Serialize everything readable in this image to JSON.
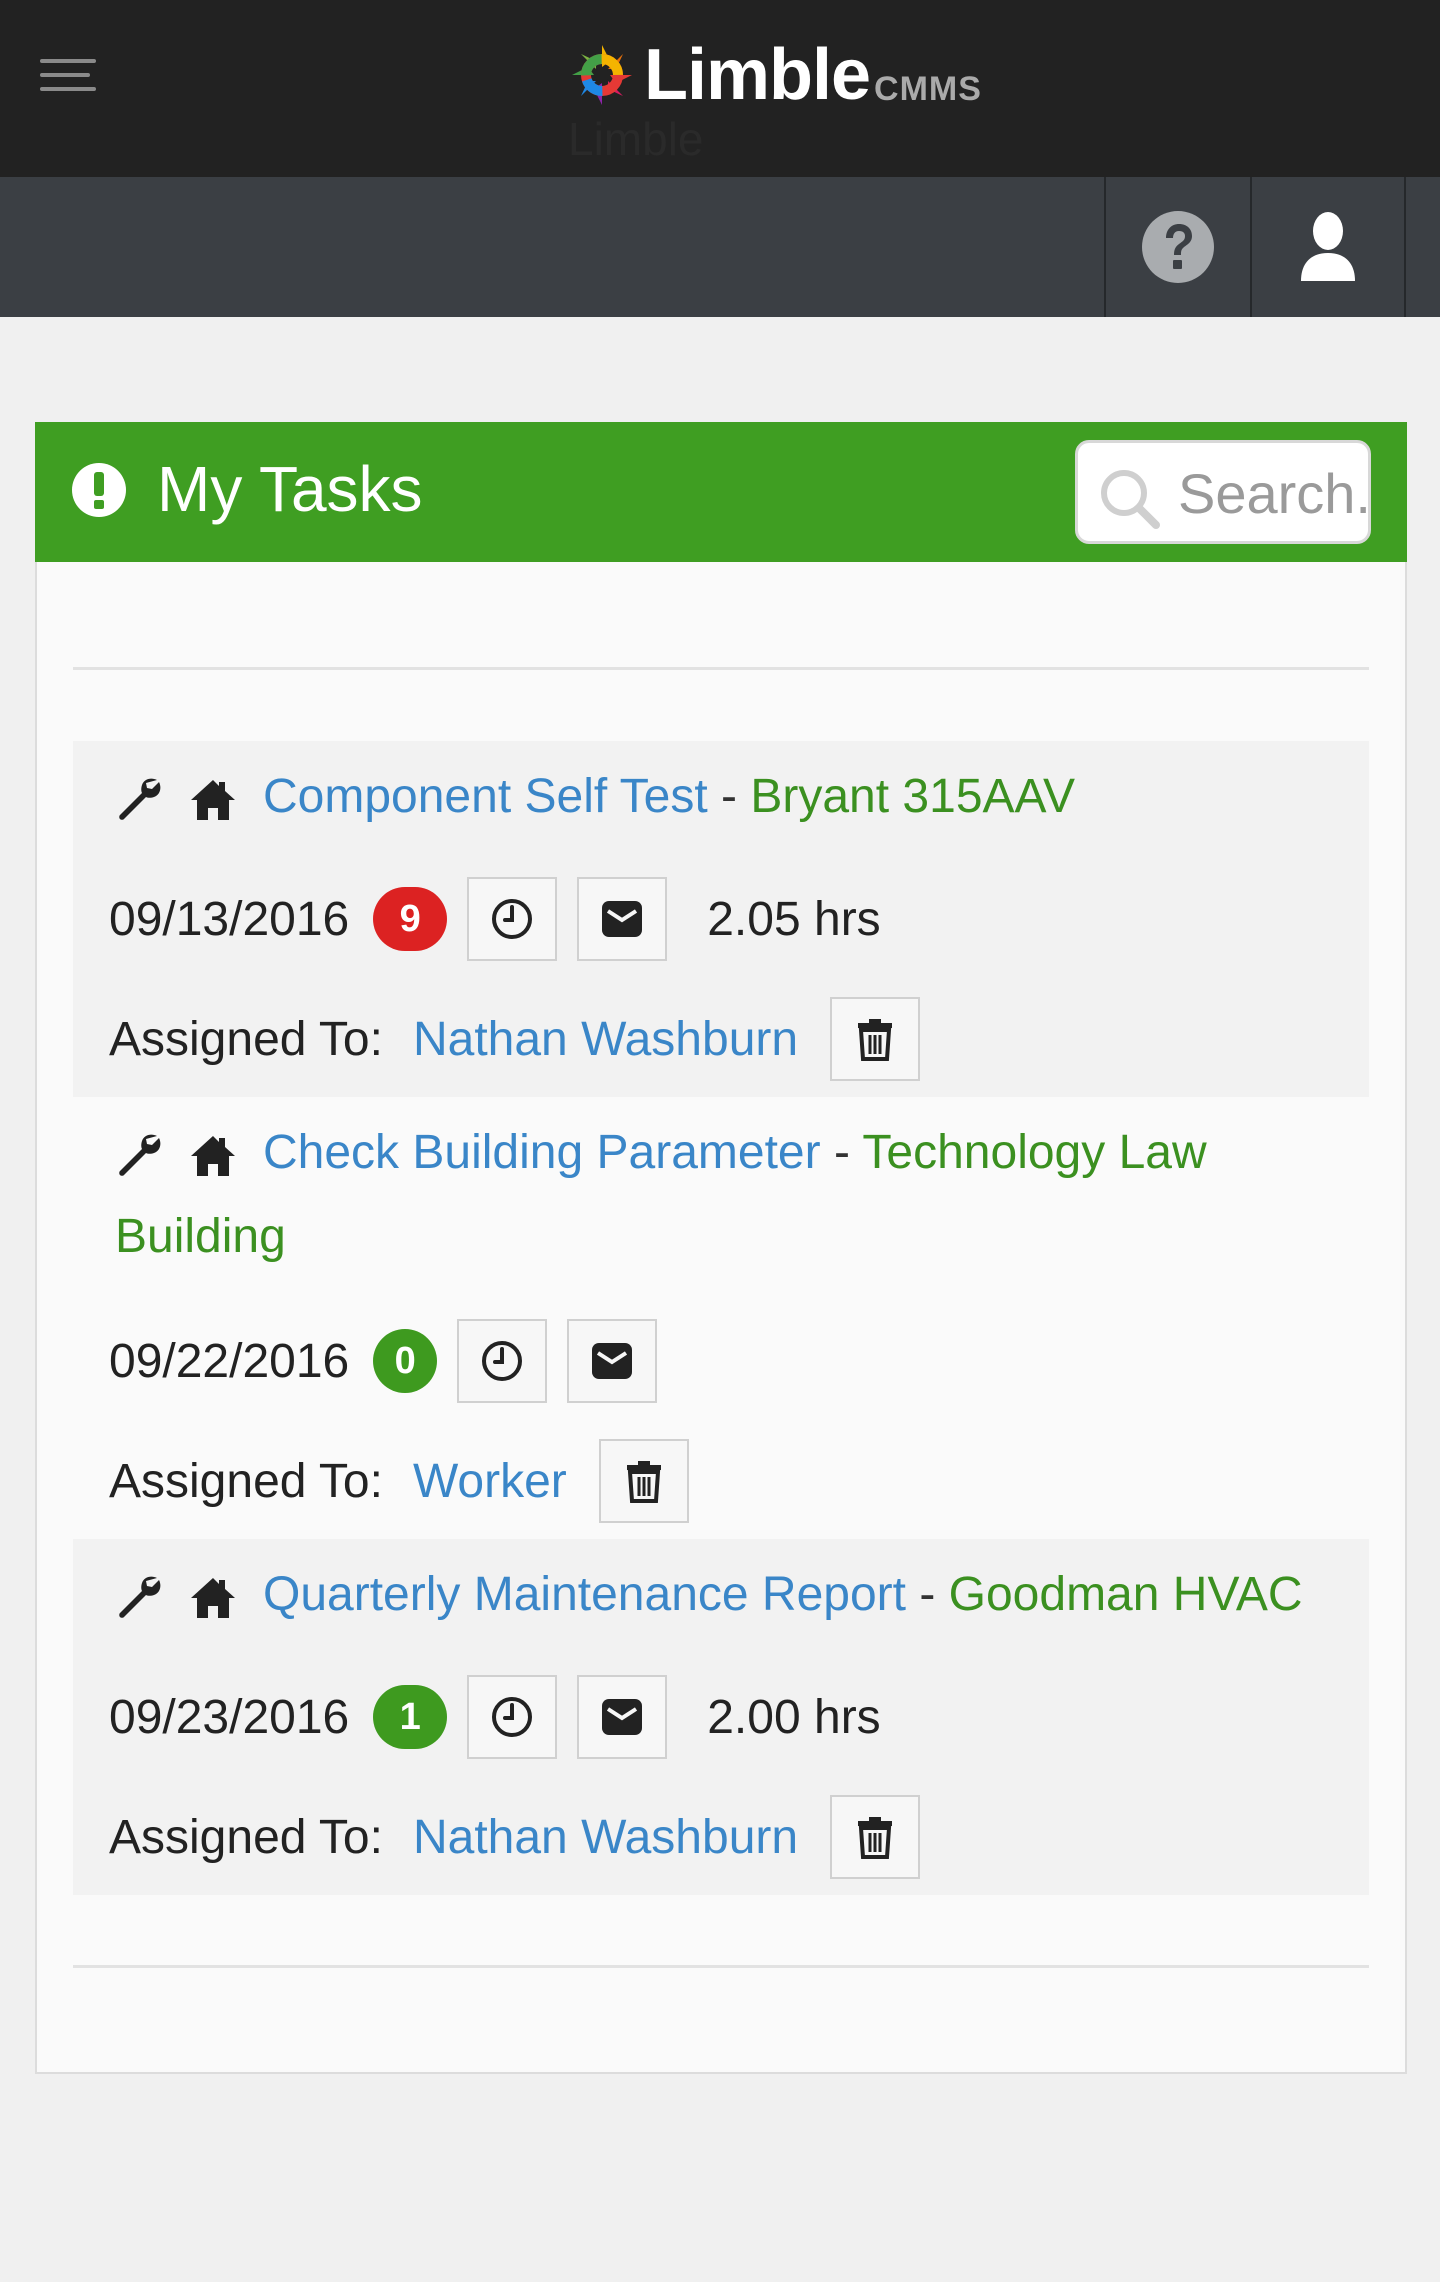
{
  "app": {
    "logo_text": "Limble",
    "logo_suffix": "CMMS",
    "ghost_title": "Limble",
    "menu_icon": "hamburger-icon",
    "help_icon": "question-circle-icon",
    "user_icon": "user-icon"
  },
  "panel": {
    "title": "My Tasks",
    "title_icon": "exclamation-circle-icon",
    "search_placeholder": "Search...",
    "header_color": "#3f9e22"
  },
  "tasks": [
    {
      "title": "Component Self Test",
      "separator": " - ",
      "asset": "Bryant 315AAV",
      "date": "09/13/2016",
      "badge": "9",
      "badge_color": "#dc2222",
      "hours": "2.05 hrs",
      "assigned_label": "Assigned To:",
      "assignee": "Nathan Washburn"
    },
    {
      "title": "Check Building Parameter",
      "separator": " - ",
      "asset": "Technology Law Building",
      "date": "09/22/2016",
      "badge": "0",
      "badge_color": "#3e9a1f",
      "hours": "",
      "assigned_label": "Assigned To:",
      "assignee": "Worker"
    },
    {
      "title": "Quarterly Maintenance Report",
      "separator": " - ",
      "asset": "Goodman HVAC",
      "date": "09/23/2016",
      "badge": "1",
      "badge_color": "#3e9a1f",
      "hours": "2.00 hrs",
      "assigned_label": "Assigned To:",
      "assignee": "Nathan Washburn"
    }
  ],
  "colors": {
    "link_blue": "#3a86c8",
    "asset_green": "#3b9020",
    "topbar": "#222222",
    "subbar": "#3b3f44"
  }
}
